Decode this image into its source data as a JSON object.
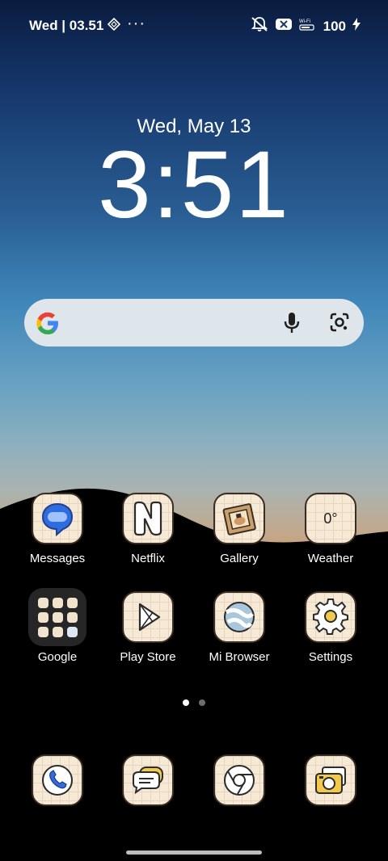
{
  "status_bar": {
    "time": "Wed | 03.51",
    "more": "···",
    "battery": "100"
  },
  "lockscreen": {
    "date": "Wed, May 13",
    "time": "3:51"
  },
  "apps_row1": [
    {
      "label": "Messages",
      "icon": "messages-icon"
    },
    {
      "label": "Netflix",
      "icon": "netflix-icon"
    },
    {
      "label": "Gallery",
      "icon": "gallery-icon"
    },
    {
      "label": "Weather",
      "icon": "weather-icon",
      "value": "0°"
    }
  ],
  "apps_row2": [
    {
      "label": "Google",
      "icon": "folder-icon"
    },
    {
      "label": "Play Store",
      "icon": "play-store-icon"
    },
    {
      "label": "Mi Browser",
      "icon": "browser-icon"
    },
    {
      "label": "Settings",
      "icon": "gear-icon"
    }
  ],
  "dock": [
    {
      "icon": "phone-icon"
    },
    {
      "icon": "chat-icon"
    },
    {
      "icon": "chrome-icon"
    },
    {
      "icon": "camera-icon"
    }
  ],
  "page_indicator": {
    "current": 1,
    "total": 2
  }
}
